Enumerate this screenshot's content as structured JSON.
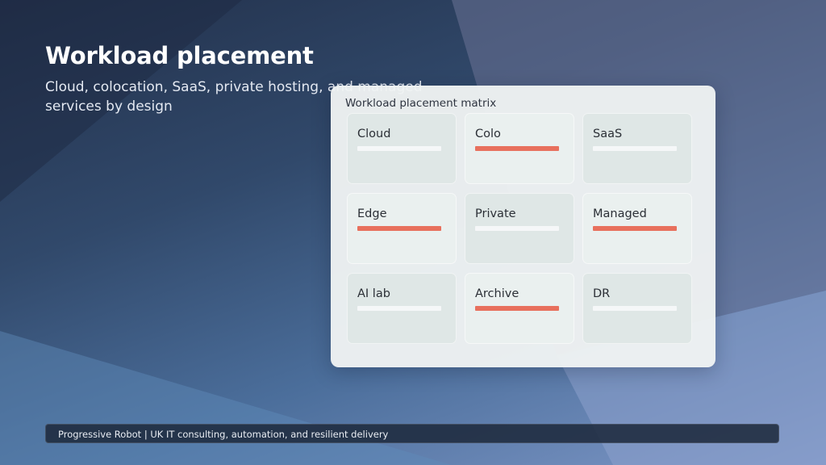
{
  "slide": {
    "title": "Workload placement",
    "subtitle": "Cloud, colocation, SaaS, private hosting, and managed services by design"
  },
  "matrix": {
    "title": "Workload placement matrix",
    "tiles": [
      {
        "label": "Cloud",
        "highlighted": false
      },
      {
        "label": "Colo",
        "highlighted": true
      },
      {
        "label": "SaaS",
        "highlighted": false
      },
      {
        "label": "Edge",
        "highlighted": true
      },
      {
        "label": "Private",
        "highlighted": false
      },
      {
        "label": "Managed",
        "highlighted": true
      },
      {
        "label": "AI lab",
        "highlighted": false
      },
      {
        "label": "Archive",
        "highlighted": true
      },
      {
        "label": "DR",
        "highlighted": false
      }
    ]
  },
  "footer": {
    "text": "Progressive Robot | UK IT consulting, automation, and resilient delivery"
  },
  "colors": {
    "accent": "#e8705d",
    "panel": "#eff2f2",
    "tile_dark": "#dfe7e6",
    "tile_light": "#eaf0ef"
  }
}
